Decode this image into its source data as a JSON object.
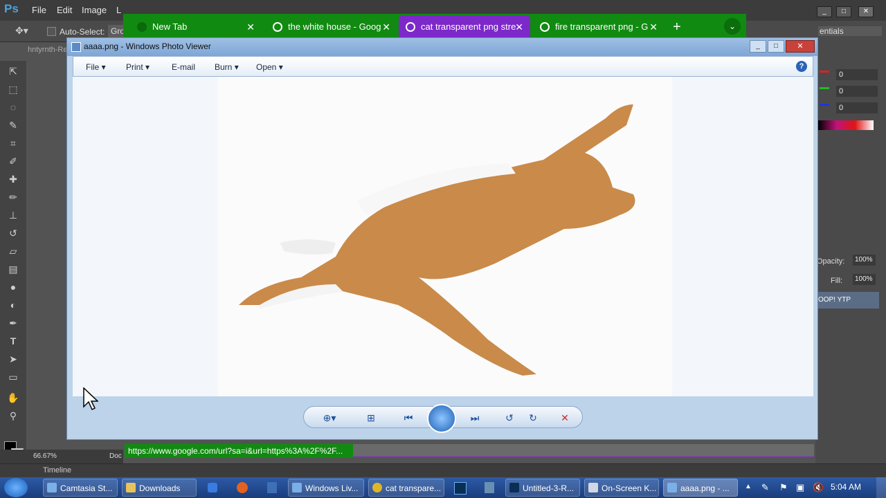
{
  "photoshop": {
    "logo": "Ps",
    "menu": [
      "File",
      "Edit",
      "Image",
      "L"
    ],
    "options": {
      "auto_select_label": "Auto-Select:",
      "group_label": "Gro"
    },
    "doc_tab": "hntyrnth-Re",
    "zoom": "66.67%",
    "doc_label": "Doc",
    "timeline_label": "Timeline",
    "workspace": "entials",
    "color_values": [
      "0",
      "0",
      "0"
    ],
    "opacity_label": "Opacity:",
    "opacity_value": "100%",
    "fill_label": "Fill:",
    "fill_value": "100%",
    "layer_name": "OOP! YTP"
  },
  "chrome": {
    "tabs": [
      {
        "label": "New Tab"
      },
      {
        "label": "the white house - Goog"
      },
      {
        "label": "cat transparent png stre"
      },
      {
        "label": "fire transparent png - G"
      }
    ],
    "new_tab": "+",
    "status_url": "https://www.google.com/url?sa=i&url=https%3A%2F%2F..."
  },
  "viewer": {
    "title": "aaaa.png - Windows Photo Viewer",
    "menu": [
      {
        "label": "File"
      },
      {
        "label": "Print"
      },
      {
        "label": "E-mail"
      },
      {
        "label": "Burn"
      },
      {
        "label": "Open"
      }
    ],
    "help": "?"
  },
  "taskbar": {
    "items": [
      {
        "label": "Camtasia St..."
      },
      {
        "label": "Downloads"
      },
      {
        "label": "Windows Liv..."
      },
      {
        "label": "cat transpare..."
      },
      {
        "label": "Untitled-3-R..."
      },
      {
        "label": "On-Screen K..."
      },
      {
        "label": "aaaa.png - ..."
      }
    ],
    "clock": "5:04 AM"
  },
  "colors": {
    "chrome_green": "#118a11",
    "active_tab_purple": "#7d28c9",
    "viewer_blue": "#bcd3ea"
  }
}
